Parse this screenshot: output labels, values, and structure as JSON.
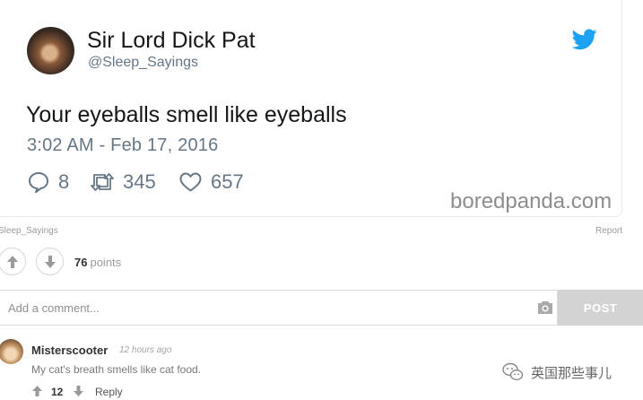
{
  "tweet": {
    "author_name": "Sir Lord Dick Pat",
    "author_handle": "@Sleep_Sayings",
    "text": "Your eyeballs smell like eyeballs",
    "timestamp": "3:02 AM - Feb 17, 2016",
    "replies": "8",
    "retweets": "345",
    "likes": "657",
    "brand_color": "#1da1f2"
  },
  "watermark": "boredpanda.com",
  "post_meta": {
    "source_handle": "Sleep_Sayings",
    "report_label": "Report"
  },
  "votes": {
    "count": "76",
    "unit": "points"
  },
  "comment_form": {
    "placeholder": "Add a comment...",
    "post_label": "POST"
  },
  "comments": [
    {
      "user": "Misterscooter",
      "time": "12 hours ago",
      "text": "My cat's breath smells like cat food.",
      "votes": "12",
      "reply_label": "Reply"
    }
  ],
  "overlay": {
    "wechat_label": "英国那些事儿"
  }
}
